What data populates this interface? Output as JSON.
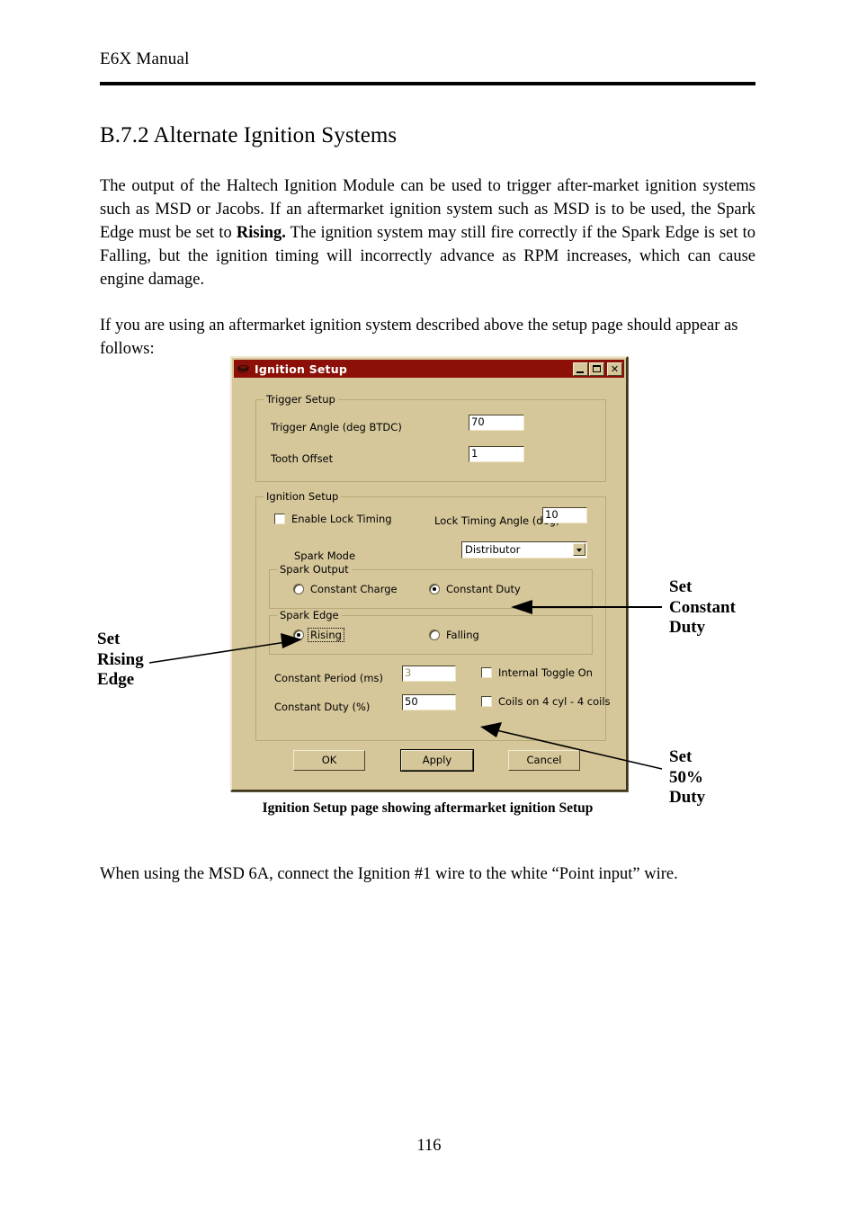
{
  "document": {
    "running_head": "E6X Manual",
    "section_title": "B.7.2 Alternate Ignition Systems",
    "paragraph_1_a": "The output of the Haltech Ignition Module can be used to trigger after-market ignition systems such as MSD or Jacobs. If an aftermarket ignition system such as MSD is to be used, the Spark Edge must be set to ",
    "paragraph_1_bold": "Rising.",
    "paragraph_1_b": " The ignition system may still fire correctly if the Spark Edge is set to Falling, but the ignition timing will incorrectly advance as RPM increases, which can cause engine damage.",
    "paragraph_2": "If you are using an aftermarket ignition system described above the setup page should appear as follows:",
    "figure_caption": "Ignition Setup page showing aftermarket ignition Setup",
    "paragraph_3": "When using the MSD 6A, connect the Ignition #1 wire to the white “Point input” wire.",
    "page_number": "116"
  },
  "annotations": [
    {
      "id": "set-constant-duty",
      "lines": [
        "Set",
        "Constant",
        "Duty"
      ]
    },
    {
      "id": "set-rising-edge",
      "lines": [
        "Set",
        "Rising",
        "Edge"
      ]
    },
    {
      "id": "set-50-duty",
      "lines": [
        "Set",
        "50%",
        "Duty"
      ]
    }
  ],
  "dialog": {
    "title": "Ignition Setup",
    "title_icon": "application-icon",
    "window_buttons": {
      "minimize": "minimize-icon",
      "maximize": "maximize-icon",
      "close": "✕"
    },
    "trigger_setup": {
      "group_label": "Trigger Setup",
      "trigger_angle_label": "Trigger Angle (deg BTDC)",
      "trigger_angle_value": "70",
      "tooth_offset_label": "Tooth Offset",
      "tooth_offset_value": "1"
    },
    "ignition_setup": {
      "group_label": "Ignition Setup",
      "enable_lock_timing_label": "Enable Lock Timing",
      "enable_lock_timing_checked": false,
      "lock_timing_angle_label": "Lock Timing Angle (deg)",
      "lock_timing_angle_value": "10",
      "spark_mode_label": "Spark Mode",
      "spark_mode_value": "Distributor",
      "spark_output": {
        "group_label": "Spark Output",
        "option_constant_charge": "Constant Charge",
        "option_constant_duty": "Constant Duty",
        "selected": "Constant Duty"
      },
      "spark_edge": {
        "group_label": "Spark Edge",
        "option_rising": "Rising",
        "option_falling": "Falling",
        "selected": "Rising"
      },
      "constant_period_label": "Constant Period (ms)",
      "constant_period_value": "3",
      "constant_period_enabled": false,
      "constant_duty_label": "Constant Duty (%)",
      "constant_duty_value": "50",
      "internal_toggle_label": "Internal Toggle On",
      "internal_toggle_checked": false,
      "coils_label": "Coils on 4 cyl - 4 coils",
      "coils_checked": false
    },
    "buttons": {
      "ok": "OK",
      "apply": "Apply",
      "cancel": "Cancel"
    },
    "colors": {
      "titlebar": "#8c1007",
      "face": "#d6c79a",
      "field": "#ffffff",
      "group_border": "#b6a878"
    }
  }
}
